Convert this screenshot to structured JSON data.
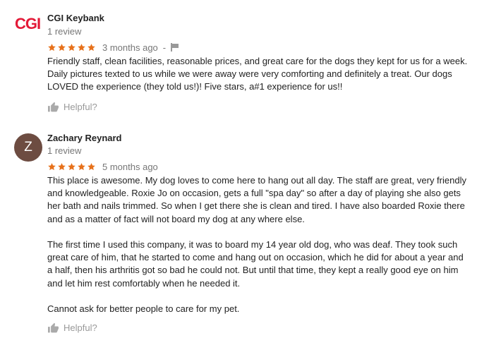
{
  "reviews": [
    {
      "avatar_text": "CGI",
      "name": "CGI Keybank",
      "review_count": "1 review",
      "rating": 5,
      "time": "3 months ago",
      "separator": "-",
      "paragraphs": [
        "Friendly staff, clean facilities, reasonable prices, and great care for the dogs they kept for us for a week. Daily pictures texted to us while we were away were very comforting and definitely a treat. Our dogs LOVED the experience (they told us!)!  Five stars, a#1 experience for us!!"
      ],
      "helpful_label": "Helpful?"
    },
    {
      "avatar_text": "Z",
      "name": "Zachary Reynard",
      "review_count": "1 review",
      "rating": 5,
      "time": "5 months ago",
      "paragraphs": [
        "This place is awesome.  My dog loves to come here to hang out all day.  The staff are great, very friendly and knowledgeable.  Roxie Jo on occasion, gets a full \"spa day\" so after a day of playing she also gets her bath and nails trimmed.  So when I get there she is clean and tired.  I have also boarded Roxie there and as a matter of fact will not board my dog at any where else.",
        "The first time I used this company, it was to board my 14 year old dog, who was deaf.  They took such great care of him, that he started to come and hang out on occasion, which he did for about a year and a half, then his arthritis got so bad he could not.  But until that time, they kept a really good eye on him and let him rest comfortably when he needed it.",
        "Cannot ask for better people to care for my pet."
      ],
      "helpful_label": "Helpful?"
    }
  ],
  "colors": {
    "star": "#e7711b",
    "logo": "#e31937",
    "avatar_bg": "#6d4c41",
    "meta_text": "#777777",
    "helpful_text": "#999999"
  },
  "icons": {
    "star": "star-icon",
    "flag": "flag-icon",
    "thumb": "thumbs-up-icon"
  }
}
